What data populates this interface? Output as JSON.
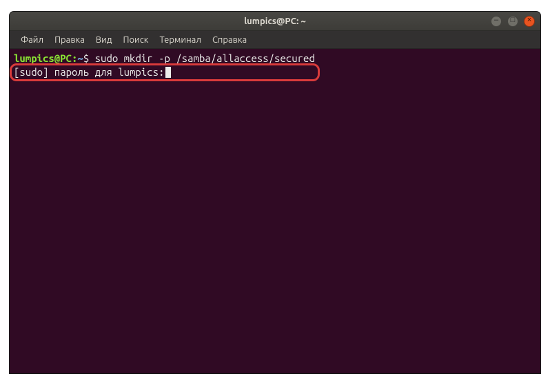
{
  "window": {
    "title": "lumpics@PC: ~"
  },
  "menu": {
    "file": "Файл",
    "edit": "Правка",
    "view": "Вид",
    "search": "Поиск",
    "terminal": "Терминал",
    "help": "Справка"
  },
  "terminal": {
    "prompt_user": "lumpics@PC",
    "prompt_sep": ":",
    "prompt_path": "~",
    "prompt_dollar": "$",
    "command": "sudo mkdir -p /samba/allaccess/secured",
    "sudo_line": "[sudo] пароль для lumpics:"
  },
  "controls": {
    "min": "–",
    "max": "□",
    "close": "×"
  }
}
